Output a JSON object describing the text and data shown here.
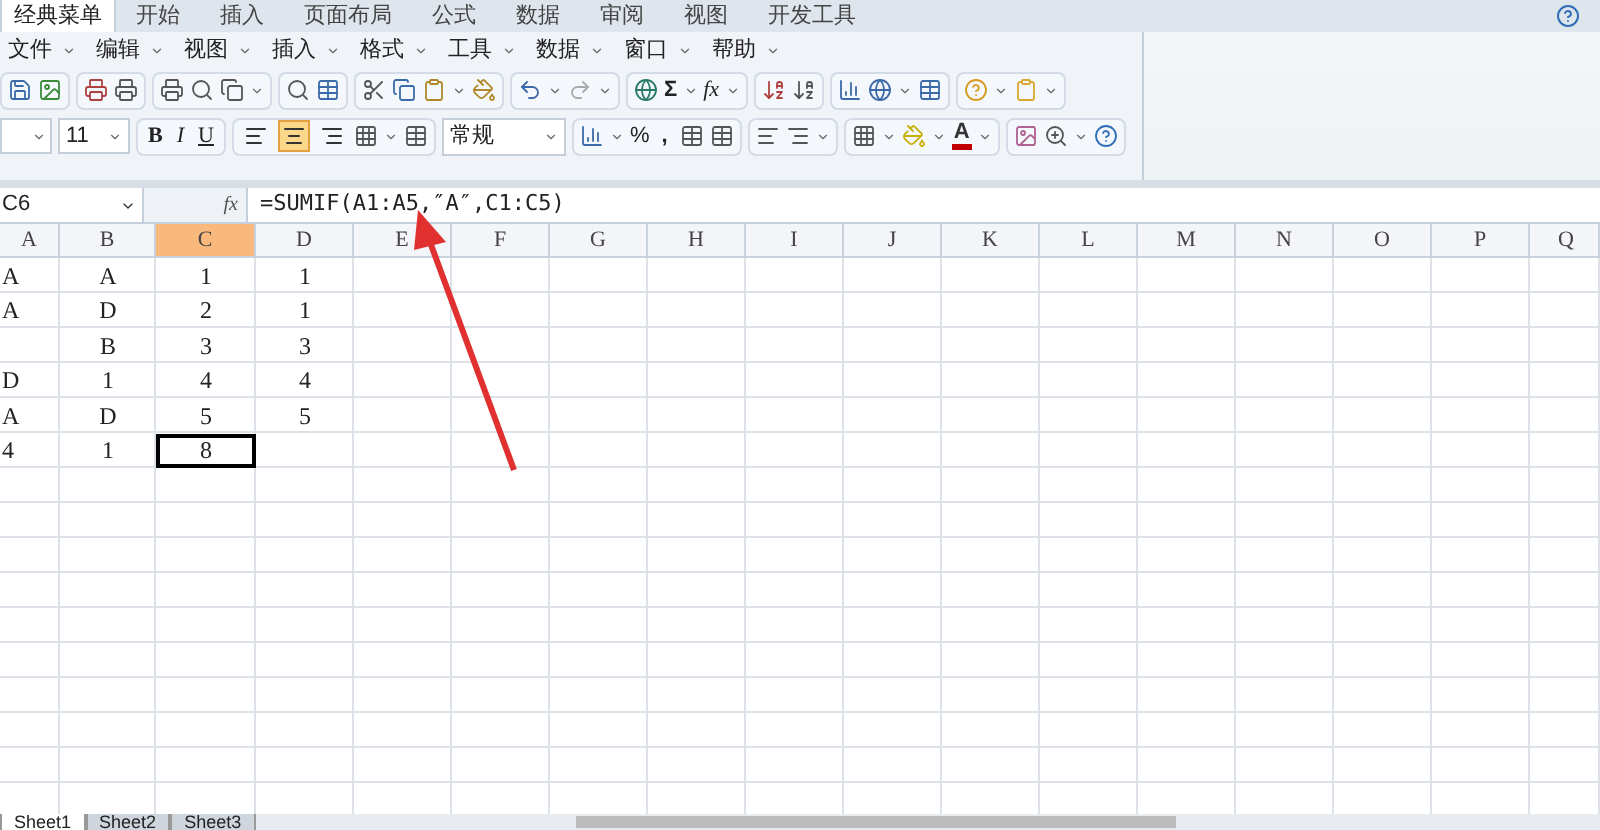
{
  "ribbon_tabs": [
    {
      "label": "经典菜单",
      "selected": true
    },
    {
      "label": "开始",
      "selected": false
    },
    {
      "label": "插入",
      "selected": false
    },
    {
      "label": "页面布局",
      "selected": false
    },
    {
      "label": "公式",
      "selected": false
    },
    {
      "label": "数据",
      "selected": false
    },
    {
      "label": "审阅",
      "selected": false
    },
    {
      "label": "视图",
      "selected": false
    },
    {
      "label": "开发工具",
      "selected": false
    }
  ],
  "menus": [
    "文件",
    "编辑",
    "视图",
    "插入",
    "格式",
    "工具",
    "数据",
    "窗口",
    "帮助"
  ],
  "toolbar": {
    "sum": "Σ",
    "function": "fx",
    "font_size": "11",
    "bold": "B",
    "italic": "I",
    "underline": "U",
    "number_format": "常规",
    "percent": "%",
    "comma": ",",
    "font_color": "A",
    "alignments": [
      {
        "selected": false
      },
      {
        "selected": true
      },
      {
        "selected": false
      }
    ]
  },
  "name_box": "C6",
  "function_label": "fx",
  "formula": "=SUMIF(A1:A5,″A″,C1:C5)",
  "columns": [
    {
      "label": "A",
      "selected": false
    },
    {
      "label": "B",
      "selected": false
    },
    {
      "label": "C",
      "selected": true
    },
    {
      "label": "D",
      "selected": false
    },
    {
      "label": "E",
      "selected": false
    },
    {
      "label": "F",
      "selected": false
    },
    {
      "label": "G",
      "selected": false
    },
    {
      "label": "H",
      "selected": false
    },
    {
      "label": "I",
      "selected": false
    },
    {
      "label": "J",
      "selected": false
    },
    {
      "label": "K",
      "selected": false
    },
    {
      "label": "L",
      "selected": false
    },
    {
      "label": "M",
      "selected": false
    },
    {
      "label": "N",
      "selected": false
    },
    {
      "label": "O",
      "selected": false
    },
    {
      "label": "P",
      "selected": false
    },
    {
      "label": "Q",
      "selected": false
    }
  ],
  "rows": [
    [
      {
        "text": "A",
        "selected": false
      },
      {
        "text": "A",
        "selected": false
      },
      {
        "text": "1",
        "selected": false
      },
      {
        "text": "1",
        "selected": false
      }
    ],
    [
      {
        "text": "A",
        "selected": false
      },
      {
        "text": "D",
        "selected": false
      },
      {
        "text": "2",
        "selected": false
      },
      {
        "text": "1",
        "selected": false
      }
    ],
    [
      {
        "selected": false
      },
      {
        "text": "B",
        "selected": false
      },
      {
        "text": "3",
        "selected": false
      },
      {
        "text": "3",
        "selected": false
      }
    ],
    [
      {
        "text": "D",
        "selected": false
      },
      {
        "text": "1",
        "selected": false
      },
      {
        "text": "4",
        "selected": false
      },
      {
        "text": "4",
        "selected": false
      }
    ],
    [
      {
        "text": "A",
        "selected": false
      },
      {
        "text": "D",
        "selected": false
      },
      {
        "text": "5",
        "selected": false
      },
      {
        "text": "5",
        "selected": false
      }
    ],
    [
      {
        "text": "4",
        "selected": false
      },
      {
        "text": "1",
        "selected": false
      },
      {
        "text": "8",
        "selected": true
      },
      {
        "selected": false
      }
    ]
  ],
  "sheet_tabs": [
    {
      "label": "Sheet1",
      "selected": true
    },
    {
      "label": "Sheet2",
      "selected": false
    },
    {
      "label": "Sheet3",
      "selected": false
    }
  ]
}
